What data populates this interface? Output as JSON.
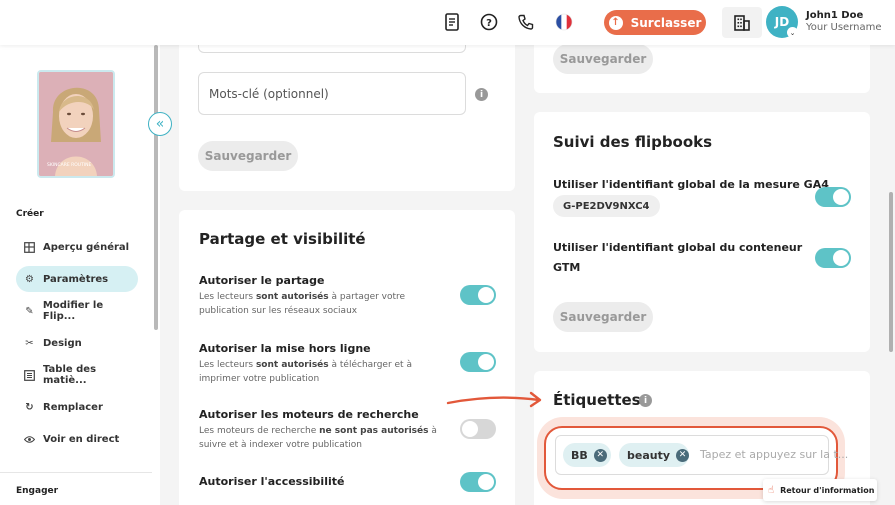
{
  "header": {
    "upgrade_label": "Surclasser",
    "user_initials": "JD",
    "user_name": "John1 Doe",
    "user_sub": "Your Username",
    "icons": [
      "document-icon",
      "help-icon",
      "phone-icon",
      "flag-fr-icon",
      "building-icon"
    ]
  },
  "sidebar": {
    "section_create": "Créer",
    "section_engage": "Engager",
    "items": [
      {
        "label": "Aperçu général",
        "icon": "layout-icon"
      },
      {
        "label": "Paramètres",
        "icon": "gear-icon"
      },
      {
        "label": "Modifier le Flip...",
        "icon": "pencil-icon"
      },
      {
        "label": "Design",
        "icon": "design-icon"
      },
      {
        "label": "Table des matiè...",
        "icon": "list-icon"
      },
      {
        "label": "Remplacer",
        "icon": "refresh-icon"
      },
      {
        "label": "Voir en direct",
        "icon": "eye-icon"
      }
    ],
    "thumb_caption": "SKINCARE ROUTINE"
  },
  "left_card": {
    "keywords_placeholder": "Mots-clé (optionnel)",
    "save_label": "Sauvegarder"
  },
  "sharing": {
    "title": "Partage et visibilité",
    "options": [
      {
        "title": "Autoriser le partage",
        "desc_pre": "Les lecteurs ",
        "desc_bold": "sont autorisés",
        "desc_post": " à partager votre publication sur les réseaux sociaux",
        "on": true
      },
      {
        "title": "Autoriser la mise hors ligne",
        "desc_pre": "Les lecteurs ",
        "desc_bold": "sont autorisés",
        "desc_post": " à télécharger et à imprimer votre publication",
        "on": true
      },
      {
        "title": "Autoriser les moteurs de recherche",
        "desc_pre": "Les moteurs de recherche ",
        "desc_bold": "ne sont pas autorisés",
        "desc_post": " à suivre et à indexer votre publication",
        "on": false
      },
      {
        "title": "Autoriser l'accessibilité",
        "desc_pre": "",
        "desc_bold": "",
        "desc_post": "",
        "on": true
      }
    ]
  },
  "right_top": {
    "save_label": "Sauvegarder"
  },
  "tracking": {
    "title": "Suivi des flipbooks",
    "ga4_label": "Utiliser l'identifiant global de la mesure GA4",
    "ga4_id": "G-PE2DV9NXC4",
    "gtm_label_1": "Utiliser l'identifiant global du conteneur",
    "gtm_label_2": "GTM",
    "save_label": "Sauvegarder"
  },
  "tags": {
    "title": "Étiquettes",
    "chips": [
      "BB",
      "beauty"
    ],
    "placeholder": "Tapez et appuyez sur la t...",
    "feedback_label": "Retour d'information"
  },
  "colors": {
    "accent": "#3fb2c4",
    "brand_orange": "#e96d4a",
    "toggle_on": "#5ec3c7"
  }
}
